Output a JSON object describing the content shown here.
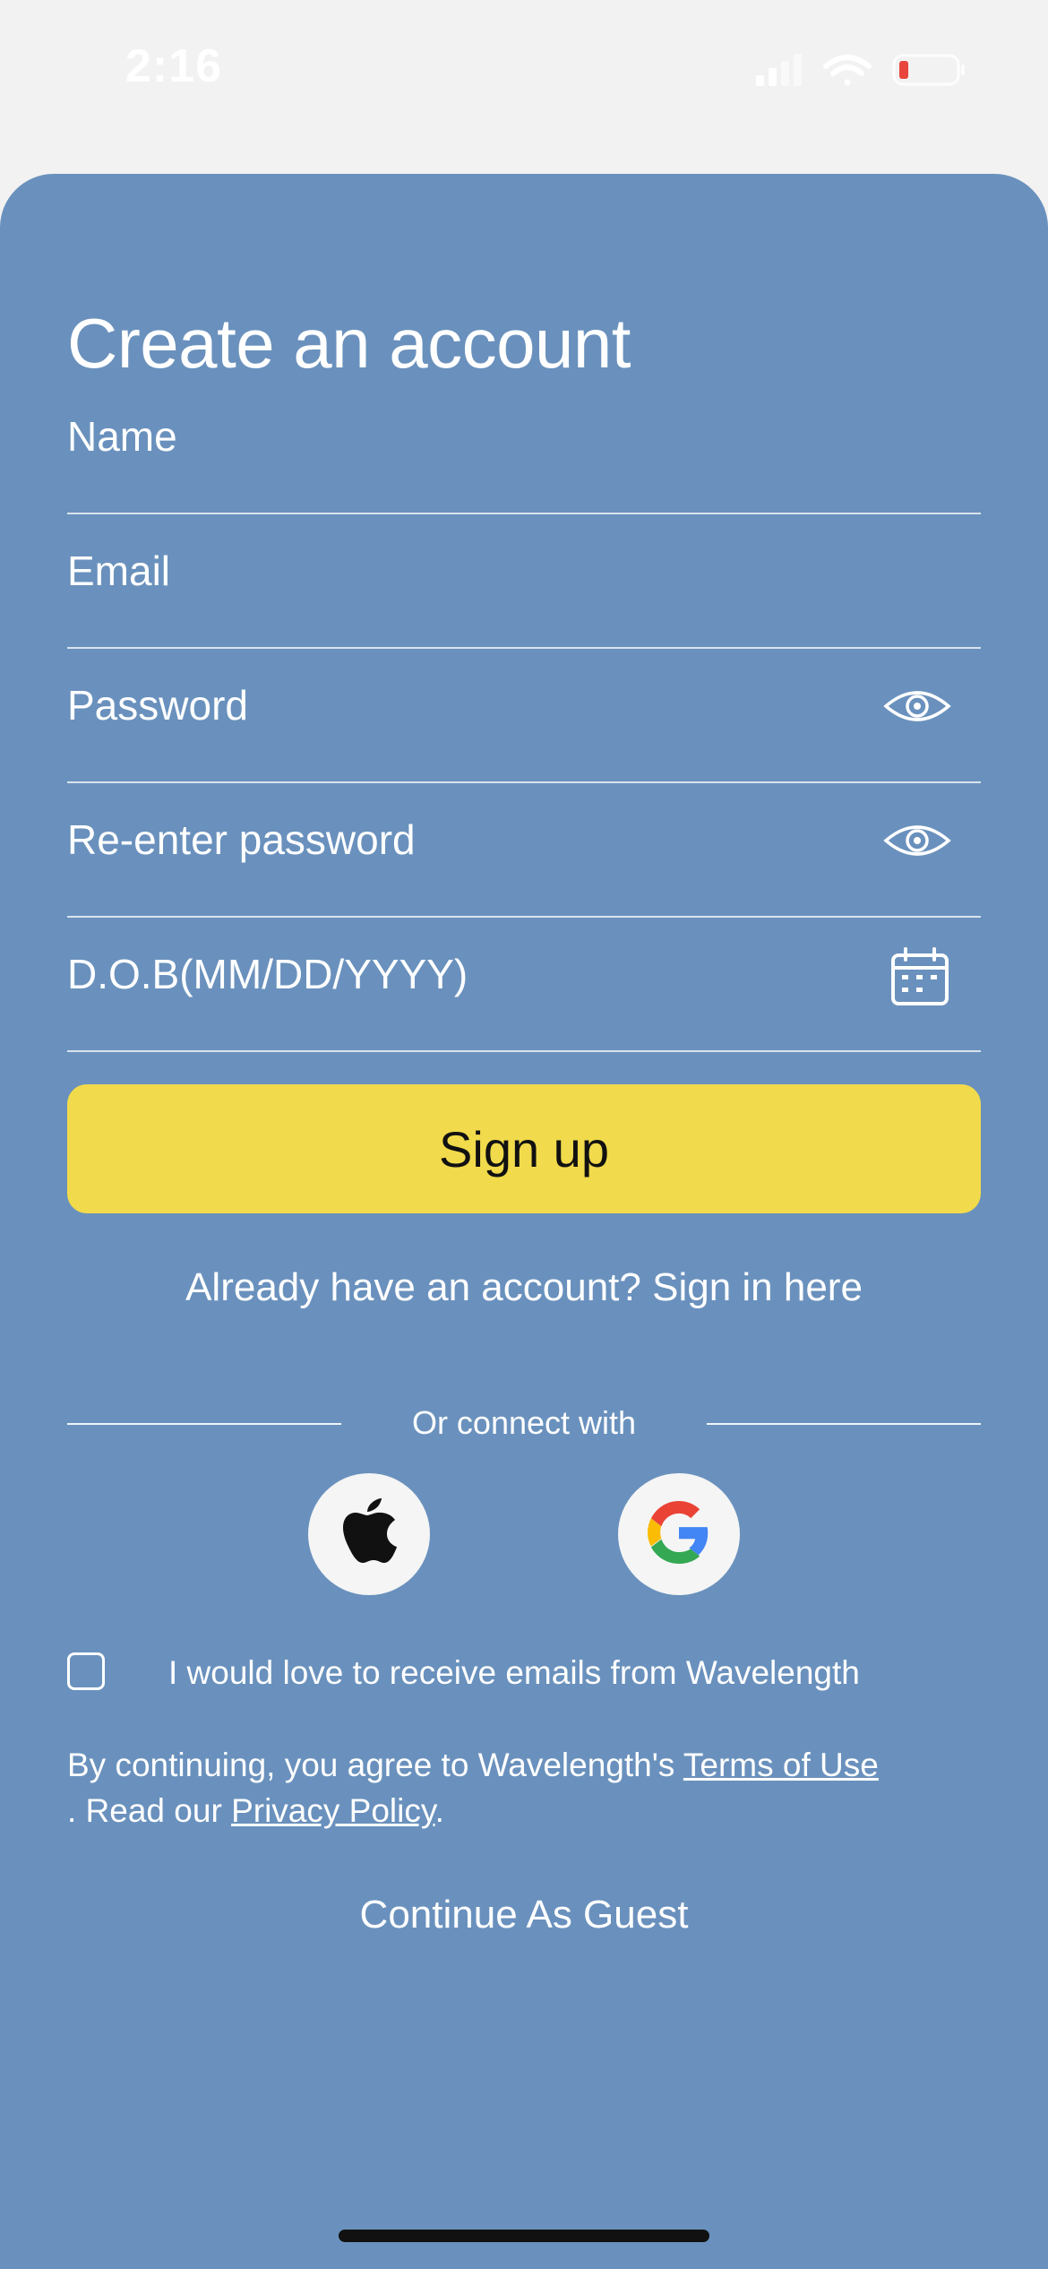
{
  "status_bar": {
    "time": "2:16"
  },
  "form": {
    "title": "Create an account",
    "fields": [
      {
        "label": "Name"
      },
      {
        "label": "Email"
      },
      {
        "label": "Password",
        "icon": "eye-icon"
      },
      {
        "label": "Re-enter password",
        "icon": "eye-icon"
      },
      {
        "label": "D.O.B(MM/DD/YYYY)",
        "icon": "calendar-icon"
      }
    ],
    "signup_label": "Sign up",
    "signin_text": "Already have an account? Sign in here",
    "connect_text": "Or connect with",
    "social": [
      {
        "icon": "apple-icon"
      },
      {
        "icon": "google-icon"
      }
    ],
    "email_optin_label": "I would love to receive emails from Wavelength",
    "legal": {
      "prefix": "By continuing, you agree to Wavelength's ",
      "terms_link": "Terms of Use",
      "middle": ". Read our ",
      "privacy_link": "Privacy Policy",
      "suffix": "."
    },
    "guest_label": "Continue As Guest"
  },
  "colors": {
    "sheet_background": "#6a91bd",
    "signup_button": "#f1da4b",
    "page_background": "#f2f2f2"
  }
}
